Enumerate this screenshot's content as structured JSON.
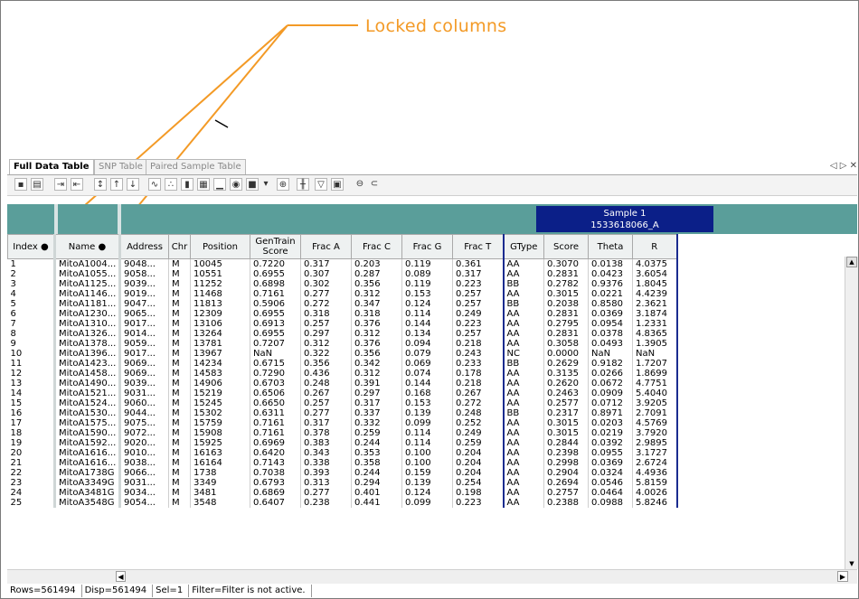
{
  "annotation": {
    "label": "Locked columns"
  },
  "tabs": [
    {
      "label": "Full Data Table",
      "active": true
    },
    {
      "label": "SNP Table",
      "active": false
    },
    {
      "label": "Paired Sample Table",
      "active": false
    }
  ],
  "window_controls": "◁ ▷ ✕",
  "toolbar": {
    "icons": [
      "print-icon",
      "copy-icon",
      "export-icon",
      "import-icon",
      "sort-icon",
      "sort-asc-icon",
      "sort-desc-icon",
      "plot-icon",
      "scatter-icon",
      "bar-chart-icon",
      "graph-icon",
      "histogram-icon",
      "heatmap-icon",
      "color-icon",
      "dropdown-icon",
      "zoom-icon",
      "column-icon",
      "filter-icon",
      "filter-options-icon",
      "lock-icon",
      "unlock-icon"
    ]
  },
  "sample_header": {
    "line1": "Sample 1",
    "line2": "1533618066_A"
  },
  "columns": [
    "Index",
    "Name",
    "Address",
    "Chr",
    "Position",
    "GenTrain Score",
    "Frac A",
    "Frac C",
    "Frac G",
    "Frac T",
    "GType",
    "Score",
    "Theta",
    "R"
  ],
  "rows": [
    [
      "1",
      "MitoA1004...",
      "9048...",
      "M",
      "10045",
      "0.7220",
      "0.317",
      "0.203",
      "0.119",
      "0.361",
      "AA",
      "0.3070",
      "0.0138",
      "4.0375"
    ],
    [
      "2",
      "MitoA1055...",
      "9058...",
      "M",
      "10551",
      "0.6955",
      "0.307",
      "0.287",
      "0.089",
      "0.317",
      "AA",
      "0.2831",
      "0.0423",
      "3.6054"
    ],
    [
      "3",
      "MitoA1125...",
      "9039...",
      "M",
      "11252",
      "0.6898",
      "0.302",
      "0.356",
      "0.119",
      "0.223",
      "BB",
      "0.2782",
      "0.9376",
      "1.8045"
    ],
    [
      "4",
      "MitoA1146...",
      "9019...",
      "M",
      "11468",
      "0.7161",
      "0.277",
      "0.312",
      "0.153",
      "0.257",
      "AA",
      "0.3015",
      "0.0221",
      "4.4239"
    ],
    [
      "5",
      "MitoA1181...",
      "9047...",
      "M",
      "11813",
      "0.5906",
      "0.272",
      "0.347",
      "0.124",
      "0.257",
      "BB",
      "0.2038",
      "0.8580",
      "2.3621"
    ],
    [
      "6",
      "MitoA1230...",
      "9065...",
      "M",
      "12309",
      "0.6955",
      "0.318",
      "0.318",
      "0.114",
      "0.249",
      "AA",
      "0.2831",
      "0.0369",
      "3.1874"
    ],
    [
      "7",
      "MitoA1310...",
      "9017...",
      "M",
      "13106",
      "0.6913",
      "0.257",
      "0.376",
      "0.144",
      "0.223",
      "AA",
      "0.2795",
      "0.0954",
      "1.2331"
    ],
    [
      "8",
      "MitoA1326...",
      "9014...",
      "M",
      "13264",
      "0.6955",
      "0.297",
      "0.312",
      "0.134",
      "0.257",
      "AA",
      "0.2831",
      "0.0378",
      "4.8365"
    ],
    [
      "9",
      "MitoA1378...",
      "9059...",
      "M",
      "13781",
      "0.7207",
      "0.312",
      "0.376",
      "0.094",
      "0.218",
      "AA",
      "0.3058",
      "0.0493",
      "1.3905"
    ],
    [
      "10",
      "MitoA1396...",
      "9017...",
      "M",
      "13967",
      "NaN",
      "0.322",
      "0.356",
      "0.079",
      "0.243",
      "NC",
      "0.0000",
      "NaN",
      "NaN"
    ],
    [
      "11",
      "MitoA1423...",
      "9069...",
      "M",
      "14234",
      "0.6715",
      "0.356",
      "0.342",
      "0.069",
      "0.233",
      "BB",
      "0.2629",
      "0.9182",
      "1.7207"
    ],
    [
      "12",
      "MitoA1458...",
      "9069...",
      "M",
      "14583",
      "0.7290",
      "0.436",
      "0.312",
      "0.074",
      "0.178",
      "AA",
      "0.3135",
      "0.0266",
      "1.8699"
    ],
    [
      "13",
      "MitoA1490...",
      "9039...",
      "M",
      "14906",
      "0.6703",
      "0.248",
      "0.391",
      "0.144",
      "0.218",
      "AA",
      "0.2620",
      "0.0672",
      "4.7751"
    ],
    [
      "14",
      "MitoA1521...",
      "9031...",
      "M",
      "15219",
      "0.6506",
      "0.267",
      "0.297",
      "0.168",
      "0.267",
      "AA",
      "0.2463",
      "0.0909",
      "5.4040"
    ],
    [
      "15",
      "MitoA1524...",
      "9060...",
      "M",
      "15245",
      "0.6650",
      "0.257",
      "0.317",
      "0.153",
      "0.272",
      "AA",
      "0.2577",
      "0.0712",
      "3.9205"
    ],
    [
      "16",
      "MitoA1530...",
      "9044...",
      "M",
      "15302",
      "0.6311",
      "0.277",
      "0.337",
      "0.139",
      "0.248",
      "BB",
      "0.2317",
      "0.8971",
      "2.7091"
    ],
    [
      "17",
      "MitoA1575...",
      "9075...",
      "M",
      "15759",
      "0.7161",
      "0.317",
      "0.332",
      "0.099",
      "0.252",
      "AA",
      "0.3015",
      "0.0203",
      "4.5769"
    ],
    [
      "18",
      "MitoA1590...",
      "9072...",
      "M",
      "15908",
      "0.7161",
      "0.378",
      "0.259",
      "0.114",
      "0.249",
      "AA",
      "0.3015",
      "0.0219",
      "3.7920"
    ],
    [
      "19",
      "MitoA1592...",
      "9020...",
      "M",
      "15925",
      "0.6969",
      "0.383",
      "0.244",
      "0.114",
      "0.259",
      "AA",
      "0.2844",
      "0.0392",
      "2.9895"
    ],
    [
      "20",
      "MitoA1616...",
      "9010...",
      "M",
      "16163",
      "0.6420",
      "0.343",
      "0.353",
      "0.100",
      "0.204",
      "AA",
      "0.2398",
      "0.0955",
      "3.1727"
    ],
    [
      "21",
      "MitoA1616...",
      "9038...",
      "M",
      "16164",
      "0.7143",
      "0.338",
      "0.358",
      "0.100",
      "0.204",
      "AA",
      "0.2998",
      "0.0369",
      "2.6724"
    ],
    [
      "22",
      "MitoA1738G",
      "9066...",
      "M",
      "1738",
      "0.7038",
      "0.393",
      "0.244",
      "0.159",
      "0.204",
      "AA",
      "0.2904",
      "0.0324",
      "4.4936"
    ],
    [
      "23",
      "MitoA3349G",
      "9031...",
      "M",
      "3349",
      "0.6793",
      "0.313",
      "0.294",
      "0.139",
      "0.254",
      "AA",
      "0.2694",
      "0.0546",
      "5.8159"
    ],
    [
      "24",
      "MitoA3481G",
      "9034...",
      "M",
      "3481",
      "0.6869",
      "0.277",
      "0.401",
      "0.124",
      "0.198",
      "AA",
      "0.2757",
      "0.0464",
      "4.0026"
    ],
    [
      "25",
      "MitoA3548G",
      "9054...",
      "M",
      "3548",
      "0.6407",
      "0.238",
      "0.441",
      "0.099",
      "0.223",
      "AA",
      "0.2388",
      "0.0988",
      "5.8246"
    ]
  ],
  "status": {
    "rows": "Rows=561494",
    "disp": "Disp=561494",
    "sel": "Sel=1",
    "filter": "Filter=Filter is not active."
  }
}
